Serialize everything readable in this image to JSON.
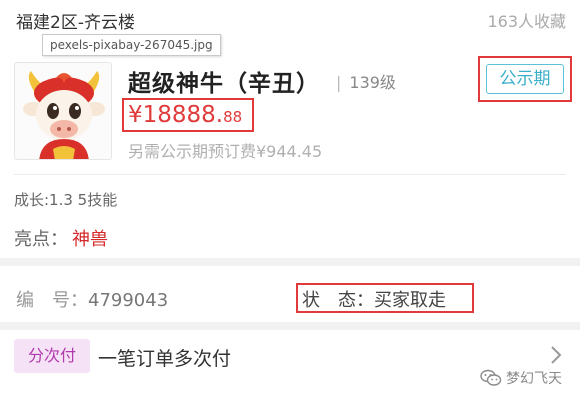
{
  "header": {
    "server": "福建2区-齐云楼",
    "favorites": "163人收藏"
  },
  "tooltip": "pexels-pixabay-267045.jpg",
  "pet": {
    "name": "超级神牛（辛丑）",
    "level_sep": "|",
    "level": "139级",
    "status_tag": "公示期",
    "price_main": "¥18888.",
    "price_cents": "88",
    "reserve_fee": "另需公示期预订费¥944.45",
    "avatar_icon": "ox-mascot-icon"
  },
  "attributes": {
    "growth": "成长:1.3 5技能",
    "highlight_label": "亮点：",
    "highlight_value": "神兽"
  },
  "info": {
    "serial_label": "编　号：",
    "serial_value": "4799043",
    "status": "状　态：买家取走"
  },
  "payment": {
    "installment_tag": "分次付",
    "installment_text": "一笔订单多次付"
  },
  "watermark": {
    "text": "梦幻飞天",
    "icon": "wechat-icon"
  },
  "colors": {
    "price": "#e03a3a",
    "highlight": "#d42a2a",
    "tag_teal": "#39aec8",
    "annotation_red": "#e23a3a",
    "installment_bg": "#f6e2f6"
  }
}
